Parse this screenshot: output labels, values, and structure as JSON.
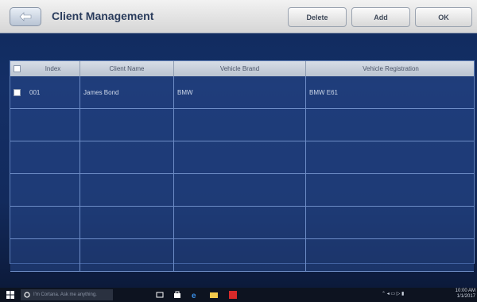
{
  "header": {
    "title": "Client Management",
    "buttons": {
      "delete": "Delete",
      "add": "Add",
      "ok": "OK"
    }
  },
  "table": {
    "columns": [
      "Index",
      "Client Name",
      "Vehicle Brand",
      "Vehicle Registration"
    ],
    "rows": [
      {
        "index": "001",
        "client_name": "James Bond",
        "vehicle_brand": "BMW",
        "vehicle_registration": "BMW E61",
        "checked": false
      },
      {
        "index": "",
        "client_name": "",
        "vehicle_brand": "",
        "vehicle_registration": "",
        "checked": false
      },
      {
        "index": "",
        "client_name": "",
        "vehicle_brand": "",
        "vehicle_registration": "",
        "checked": false
      },
      {
        "index": "",
        "client_name": "",
        "vehicle_brand": "",
        "vehicle_registration": "",
        "checked": false
      },
      {
        "index": "",
        "client_name": "",
        "vehicle_brand": "",
        "vehicle_registration": "",
        "checked": false
      },
      {
        "index": "",
        "client_name": "",
        "vehicle_brand": "",
        "vehicle_registration": "",
        "checked": false
      }
    ]
  },
  "taskbar": {
    "search_placeholder": "I'm Cortana. Ask me anything.",
    "icons": [
      "windows-start-icon",
      "task-view-icon",
      "store-icon",
      "edge-icon",
      "explorer-icon",
      "app-icon"
    ],
    "tray_time": "10:00 AM",
    "tray_date": "1/1/2017"
  },
  "colors": {
    "background": "#122a5c",
    "header_bar": "#e2e2e2",
    "table_row": "#28488c",
    "grid_line": "#6d8cc6",
    "taskbar": "#0d1320"
  }
}
